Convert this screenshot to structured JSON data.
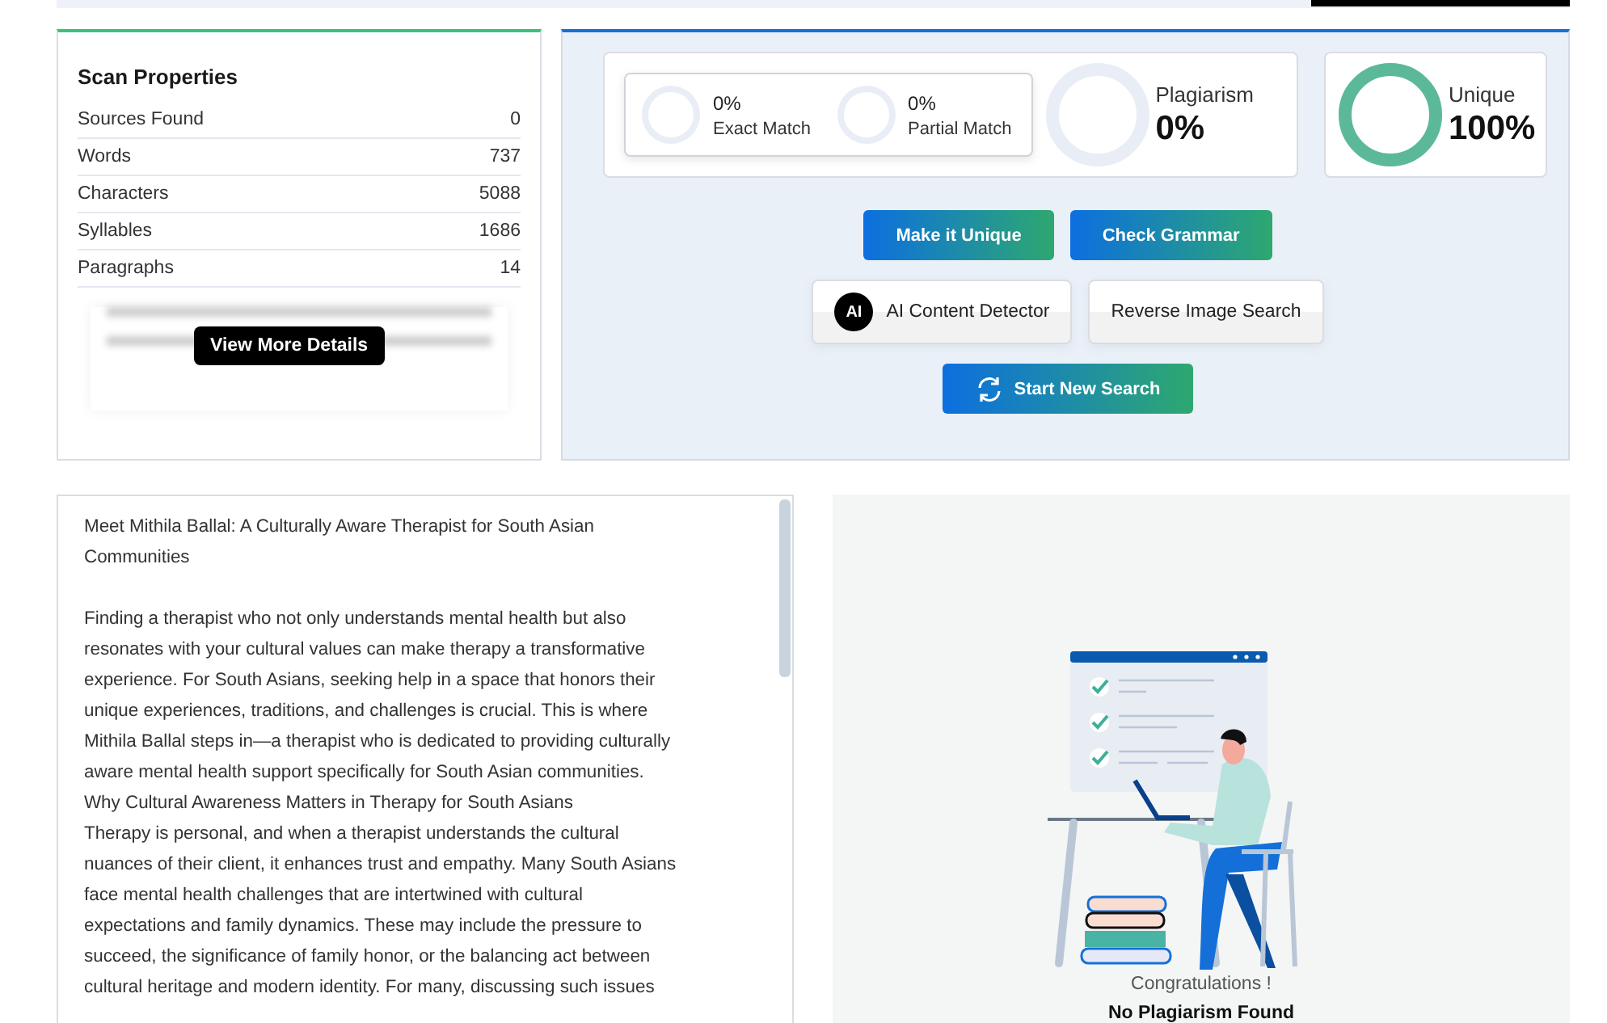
{
  "scan_properties": {
    "title": "Scan Properties",
    "rows": [
      {
        "label": "Sources Found",
        "value": "0"
      },
      {
        "label": "Words",
        "value": "737"
      },
      {
        "label": "Characters",
        "value": "5088"
      },
      {
        "label": "Syllables",
        "value": "1686"
      },
      {
        "label": "Paragraphs",
        "value": "14"
      }
    ],
    "details_button": "View More Details"
  },
  "results": {
    "matches": [
      {
        "percent": "0%",
        "label": "Exact Match",
        "level": 0
      },
      {
        "percent": "0%",
        "label": "Partial Match",
        "level": 0
      }
    ],
    "plagiarism": {
      "label": "Plagiarism",
      "percent": "0%",
      "level": 0
    },
    "unique": {
      "label": "Unique",
      "percent": "100%",
      "level": 1
    }
  },
  "actions": [
    {
      "label": "Make it Unique",
      "kind": "gradient"
    },
    {
      "label": "Check Grammar",
      "kind": "gradient"
    },
    {
      "label": "AI Content Detector",
      "kind": "light",
      "badge": "AI"
    },
    {
      "label": "Reverse Image Search",
      "kind": "light"
    },
    {
      "label": "Start New Search",
      "kind": "refresh"
    }
  ],
  "document": {
    "paragraphs": [
      {
        "lines": [
          "Meet Mithila Ballal: A Culturally Aware Therapist for South Asian",
          "Communities"
        ]
      },
      {
        "lines": [
          "Finding a therapist who not only understands mental health but also",
          "resonates with your cultural values can make therapy a transformative",
          "experience. For South Asians, seeking help in a space that honors their",
          "unique experiences, traditions, and challenges is crucial. This is where",
          "Mithila Ballal steps in—a therapist who is dedicated to providing culturally",
          "aware mental health support specifically for South Asian communities.",
          "Why Cultural Awareness Matters in Therapy for South Asians",
          "Therapy is personal, and when a therapist understands the cultural",
          "nuances of their client, it enhances trust and empathy. Many South Asians",
          "face mental health challenges that are intertwined with cultural",
          "expectations and family dynamics. These may include the pressure to",
          "succeed, the significance of family honor, or the balancing act between",
          "cultural heritage and modern identity. For many, discussing such issues"
        ]
      }
    ]
  },
  "result_panel": {
    "title": "Congratulations !",
    "message": "No Plagiarism Found"
  }
}
